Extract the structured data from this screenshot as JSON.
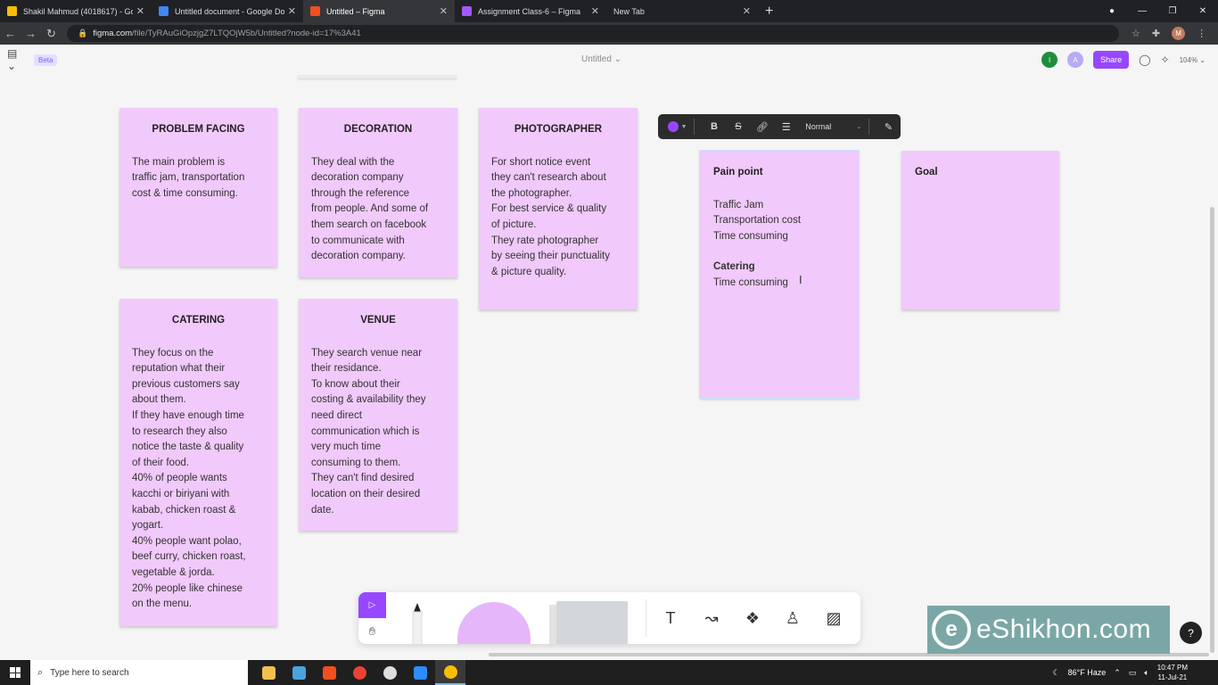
{
  "browser": {
    "tabs": [
      {
        "title": "Shakil Mahmud (4018617) - Goo",
        "color": "#fbbc04",
        "active": false
      },
      {
        "title": "Untitled document - Google Do",
        "color": "#4285f4",
        "active": false
      },
      {
        "title": "Untitled – Figma",
        "color": "#f24e1e",
        "active": true
      },
      {
        "title": "Assignment Class-6 – Figma",
        "color": "#a259ff",
        "active": false
      },
      {
        "title": "New Tab",
        "color": "#202124",
        "active": false
      }
    ],
    "url_host": "figma.com",
    "url_path": "/file/TyRAuGiOpzjgZ7LTQOjW5b/Untitled?node-id=17%3A41",
    "profile_initial": "M"
  },
  "figma": {
    "beta_label": "Beta",
    "doc_title": "Untitled ⌄",
    "avatars": [
      {
        "initial": "I",
        "color": "#1e8e3e"
      },
      {
        "initial": "A",
        "color": "#b8aaf5"
      }
    ],
    "share_label": "Share",
    "zoom": "104% ⌄",
    "text_toolbar": {
      "bold": "B",
      "strike": "S",
      "style": "Normal"
    }
  },
  "stickies": [
    {
      "heading": "PROBLEM FACING",
      "body": "The main problem is\ntraffic jam, transportation\ncost & time consuming."
    },
    {
      "heading": "DECORATION",
      "body": "They deal with the\ndecoration company\nthrough the reference\nfrom people. And some of\nthem search on facebook\nto communicate with\ndecoration company."
    },
    {
      "heading": "PHOTOGRAPHER",
      "body": "For short notice event\nthey can't research about\nthe photographer.\nFor best service & quality\nof picture.\nThey rate photographer\nby seeing their punctuality\n& picture quality."
    },
    {
      "heading": "CATERING",
      "body": "They focus on the\nreputation what their\nprevious customers say\nabout them.\nIf they have enough time\nto research they also\nnotice the taste & quality\nof their food.\n40% of people wants\nkacchi or biriyani with\nkabab, chicken roast &\nyogart.\n40% people want polao,\nbeef curry, chicken roast,\nvegetable & jorda.\n20% people like chinese\non the menu."
    },
    {
      "heading": "VENUE",
      "body": "They search venue near\ntheir residance.\nTo know about their\ncosting & availability they\nneed direct\ncommunication which is\nvery much time\nconsuming to them.\nThey can't find desired\nlocation on their desired\ndate."
    }
  ],
  "pain_point": {
    "heading": "Pain point",
    "body": "Traffic Jam\nTransportation cost\nTime consuming",
    "sub_heading": "Catering",
    "sub_body": "Time consuming"
  },
  "goal": {
    "heading": "Goal"
  },
  "watermark": {
    "text": "eShikhon.com",
    "logo_letter": "e"
  },
  "help_label": "?",
  "taskbar": {
    "search_placeholder": "Type here to search",
    "weather": "86°F  Haze",
    "time": "10:47 PM",
    "date": "11-Jul-21"
  }
}
